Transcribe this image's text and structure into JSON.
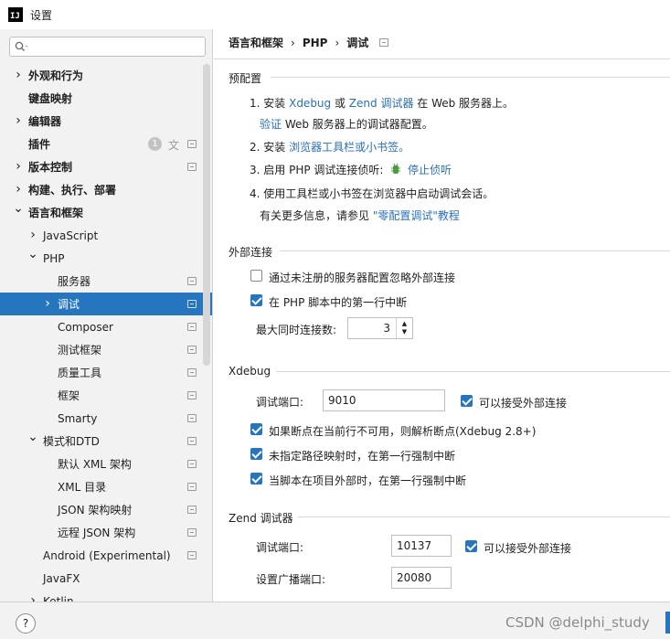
{
  "window": {
    "title": "设置",
    "app_icon": "ij-logo-icon"
  },
  "search": {
    "placeholder": ""
  },
  "tree": [
    {
      "label": "外观和行为",
      "level": 0,
      "chevron": "right",
      "bold": true
    },
    {
      "label": "键盘映射",
      "level": 0,
      "chevron": "",
      "bold": true
    },
    {
      "label": "编辑器",
      "level": 0,
      "chevron": "right",
      "bold": true
    },
    {
      "label": "插件",
      "level": 0,
      "chevron": "",
      "bold": true,
      "badge": "1"
    },
    {
      "label": "版本控制",
      "level": 0,
      "chevron": "right",
      "bold": true
    },
    {
      "label": "构建、执行、部署",
      "level": 0,
      "chevron": "right",
      "bold": true
    },
    {
      "label": "语言和框架",
      "level": 0,
      "chevron": "down",
      "bold": true
    },
    {
      "label": "JavaScript",
      "level": 1,
      "chevron": "right"
    },
    {
      "label": "PHP",
      "level": 1,
      "chevron": "down"
    },
    {
      "label": "服务器",
      "level": 2,
      "chevron": ""
    },
    {
      "label": "调试",
      "level": 2,
      "chevron": "right",
      "selected": true
    },
    {
      "label": "Composer",
      "level": 2,
      "chevron": ""
    },
    {
      "label": "测试框架",
      "level": 2,
      "chevron": ""
    },
    {
      "label": "质量工具",
      "level": 2,
      "chevron": ""
    },
    {
      "label": "框架",
      "level": 2,
      "chevron": ""
    },
    {
      "label": "Smarty",
      "level": 2,
      "chevron": ""
    },
    {
      "label": "模式和DTD",
      "level": 1,
      "chevron": "down"
    },
    {
      "label": "默认 XML 架构",
      "level": 2,
      "chevron": ""
    },
    {
      "label": "XML 目录",
      "level": 2,
      "chevron": ""
    },
    {
      "label": "JSON 架构映射",
      "level": 2,
      "chevron": ""
    },
    {
      "label": "远程 JSON 架构",
      "level": 2,
      "chevron": ""
    },
    {
      "label": "Android (Experimental)",
      "level": 1,
      "chevron": ""
    },
    {
      "label": "JavaFX",
      "level": 1,
      "chevron": ""
    },
    {
      "label": "Kotlin",
      "level": 1,
      "chevron": "right"
    }
  ],
  "breadcrumb": {
    "part1": "语言和框架",
    "part2": "PHP",
    "part3": "调试",
    "sep": "›"
  },
  "preconfig": {
    "title": "预配置",
    "s1_a": "1. 安装 ",
    "s1_link1": "Xdebug",
    "s1_b": " 或 ",
    "s1_link2": "Zend 调试器",
    "s1_c": " 在 Web 服务器上。",
    "s1_link3": "验证",
    "s1_d": " Web 服务器上的调试器配置。",
    "s2_a": "2. 安装 ",
    "s2_link": "浏览器工具栏或小书签。",
    "s3_a": "3. 启用 PHP 调试连接侦听:",
    "s3_link": "停止侦听",
    "s4": "4. 使用工具栏或小书签在浏览器中启动调试会话。",
    "s5_a": "有关更多信息，请参见 ",
    "s5_link": "\"零配置调试\"教程"
  },
  "external": {
    "title": "外部连接",
    "cb1": {
      "label": "通过未注册的服务器配置忽略外部连接",
      "checked": false
    },
    "cb2": {
      "label": "在 PHP 脚本中的第一行中断",
      "checked": true
    },
    "max_label": "最大同时连接数:",
    "max_value": "3"
  },
  "xdebug": {
    "title": "Xdebug",
    "port_label": "调试端口:",
    "port_value": "9010",
    "accept_label": "可以接受外部连接",
    "cb1": "如果断点在当前行不可用，则解析断点(Xdebug 2.8+)",
    "cb2": "未指定路径映射时，在第一行强制中断",
    "cb3": "当脚本在项目外部时，在第一行强制中断"
  },
  "zend": {
    "title": "Zend 调试器",
    "port_label": "调试端口:",
    "port_value": "10137",
    "accept_label": "可以接受外部连接",
    "broadcast_label": "设置广播端口:",
    "broadcast_value": "20080"
  },
  "bottom": {
    "help": "?",
    "watermark": "CSDN @delphi_study"
  },
  "colors": {
    "accent": "#2675bf",
    "link": "#2a6fb8",
    "sidebar_bg": "#f2f2f2"
  }
}
